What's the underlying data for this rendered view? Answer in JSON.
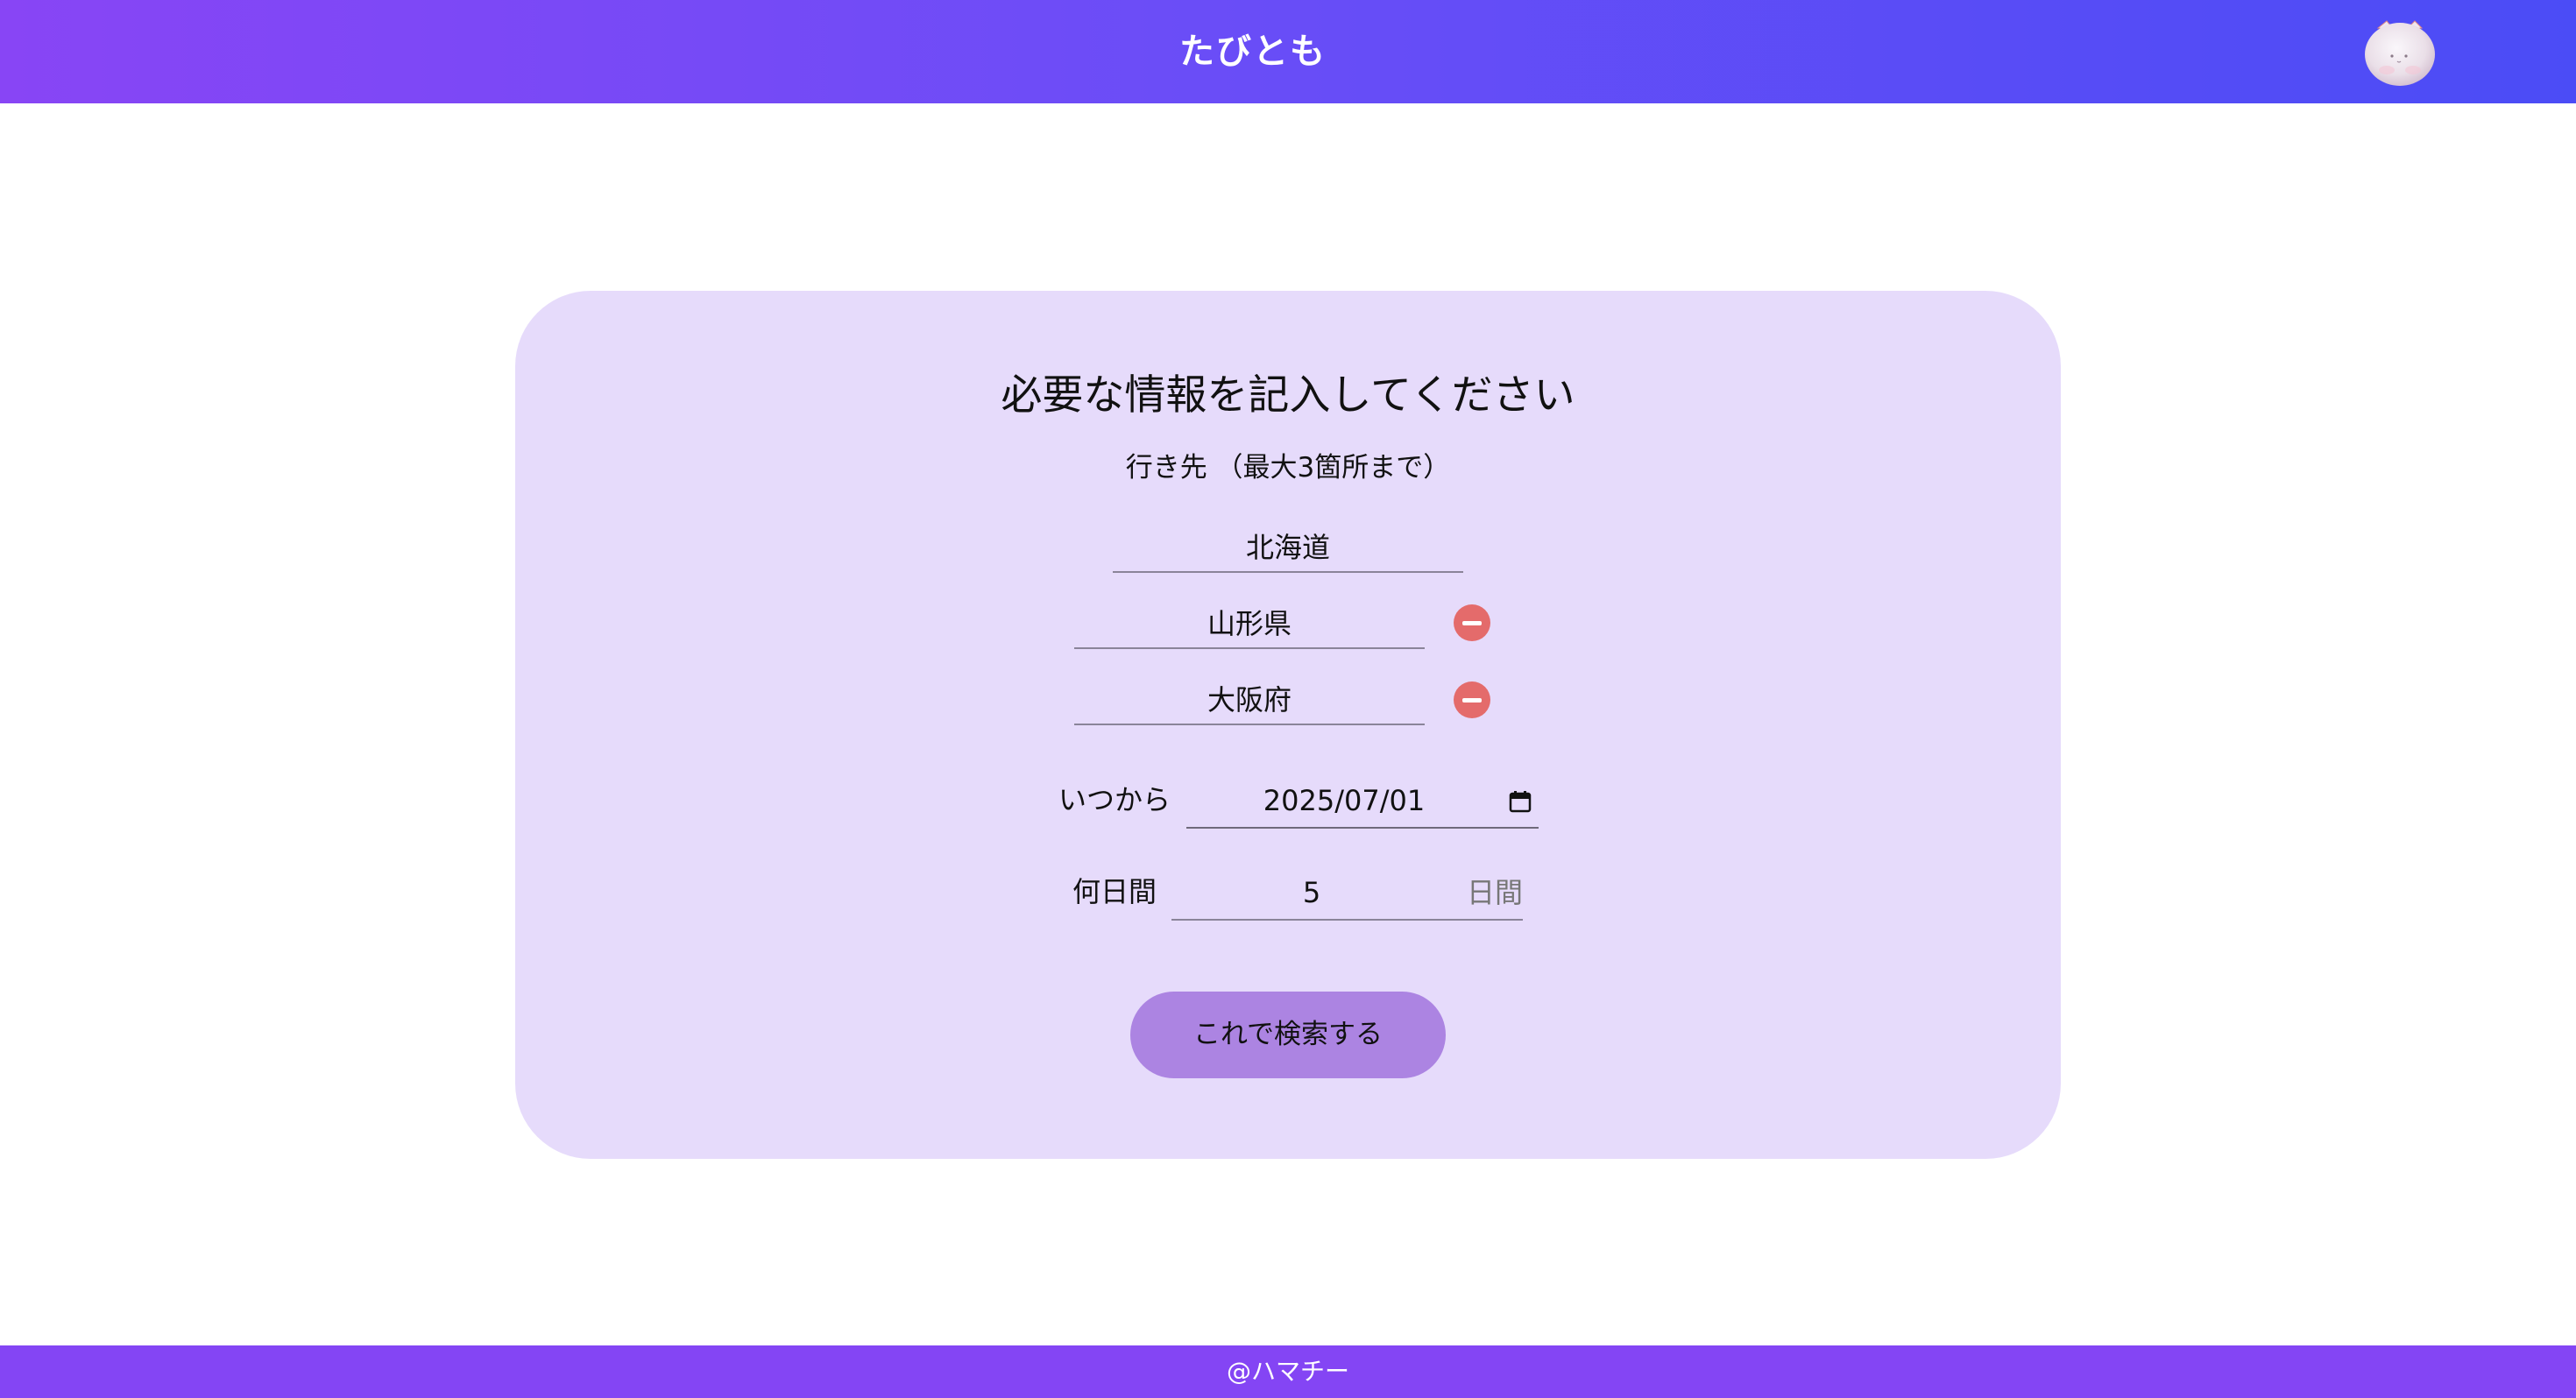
{
  "header": {
    "title": "たびとも",
    "avatar_icon": "cat-mascot-avatar"
  },
  "form": {
    "title": "必要な情報を記入してください",
    "destinations_label": "行き先 （最大3箇所まで）",
    "destinations": [
      {
        "value": "北海道"
      },
      {
        "value": "山形県",
        "remove_icon": "minus-circle-icon"
      },
      {
        "value": "大阪府",
        "remove_icon": "minus-circle-icon"
      }
    ],
    "start_label": "いつから",
    "start_date": "2025/07/01",
    "calendar_icon": "calendar-icon",
    "days_label": "何日間",
    "days_value": "5",
    "days_unit": "日間",
    "search_button": "これで検索する"
  },
  "footer": {
    "text": "@ハマチー"
  },
  "colors": {
    "header_gradient_start": "#8845f5",
    "header_gradient_end": "#4b4cf6",
    "card_background": "#e6dbfb",
    "search_button": "#ac84e2",
    "remove_button": "#e46b6b",
    "footer_background": "#8445f4"
  }
}
